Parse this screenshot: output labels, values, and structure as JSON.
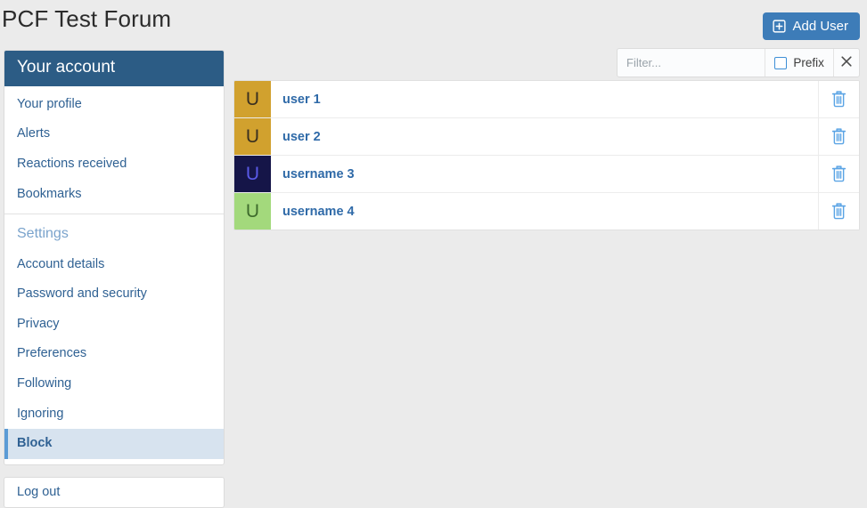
{
  "header": {
    "title": "PCF Test Forum",
    "add_user_label": "Add User",
    "add_user_icon": "plus-square-icon",
    "accent_color": "#3d7cb8"
  },
  "filter_bar": {
    "input_value": "",
    "input_placeholder": "Filter...",
    "prefix_label": "Prefix",
    "prefix_checked": false,
    "close_icon": "close-icon"
  },
  "sidebar": {
    "header": "Your account",
    "header_bg": "#2c5c85",
    "items": [
      {
        "label": "Your profile",
        "type": "link",
        "active": false
      },
      {
        "label": "Alerts",
        "type": "link",
        "active": false
      },
      {
        "label": "Reactions received",
        "type": "link",
        "active": false
      },
      {
        "label": "Bookmarks",
        "type": "link",
        "active": false
      },
      {
        "label": "Settings",
        "type": "section",
        "active": false
      },
      {
        "label": "Account details",
        "type": "link",
        "active": false
      },
      {
        "label": "Password and security",
        "type": "link",
        "active": false
      },
      {
        "label": "Privacy",
        "type": "link",
        "active": false
      },
      {
        "label": "Preferences",
        "type": "link",
        "active": false
      },
      {
        "label": "Following",
        "type": "link",
        "active": false
      },
      {
        "label": "Ignoring",
        "type": "link",
        "active": false
      },
      {
        "label": "Block",
        "type": "link",
        "active": true
      }
    ],
    "logout_label": "Log out"
  },
  "user_list": {
    "delete_icon": "trash-icon",
    "rows": [
      {
        "name": "user 1",
        "avatar_letter": "U",
        "avatar_bg": "#d1a12e",
        "avatar_fg": "#3a3020"
      },
      {
        "name": "user 2",
        "avatar_letter": "U",
        "avatar_bg": "#d1a12e",
        "avatar_fg": "#3a3020"
      },
      {
        "name": "username 3",
        "avatar_letter": "U",
        "avatar_bg": "#151548",
        "avatar_fg": "#5a5ae8"
      },
      {
        "name": "username 4",
        "avatar_letter": "U",
        "avatar_bg": "#a3d97c",
        "avatar_fg": "#3e6b2c"
      }
    ]
  }
}
